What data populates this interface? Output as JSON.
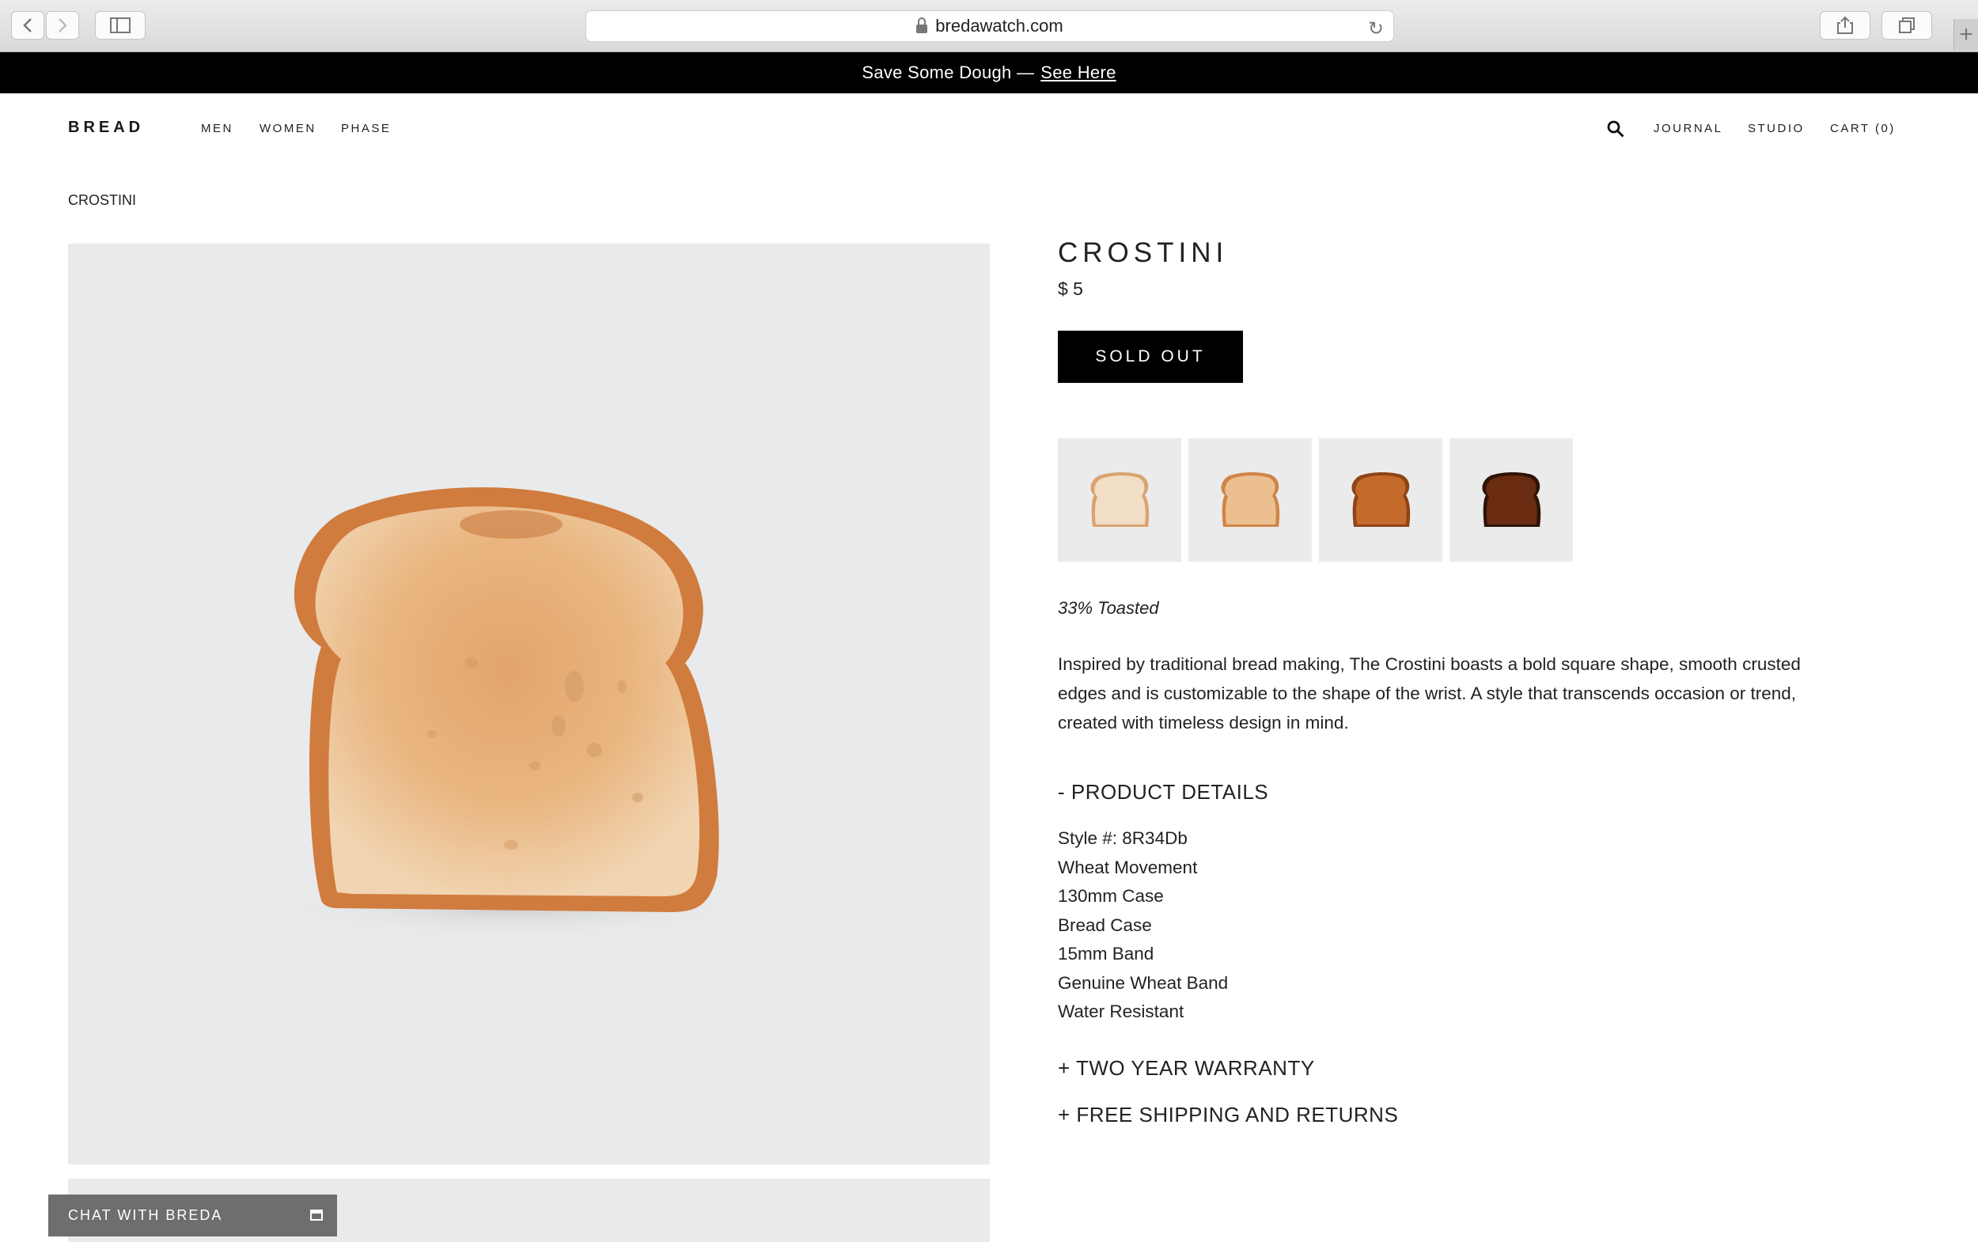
{
  "browser": {
    "url": "bredawatch.com"
  },
  "announcement": {
    "text": "Save Some Dough —",
    "link": "See Here"
  },
  "header": {
    "logo": "BREAD",
    "nav_left": [
      "MEN",
      "WOMEN",
      "PHASE"
    ],
    "nav_right": [
      "JOURNAL",
      "STUDIO",
      "CART (0)"
    ]
  },
  "breadcrumb": "CROSTINI",
  "product": {
    "title": "CROSTINI",
    "price": "$ 5",
    "button": "SOLD OUT",
    "variant": "33% Toasted",
    "description": "Inspired by traditional bread making, The Crostini boasts a bold square shape, smooth crusted edges and is customizable to the shape of the wrist. A style that transcends occasion or trend, created with timeless design in mind.",
    "details_heading": "- PRODUCT DETAILS",
    "details": [
      "Style #: 8R34Db",
      "Wheat Movement",
      "130mm Case",
      "Bread Case",
      "15mm Band",
      "Genuine Wheat Band",
      "Water Resistant"
    ],
    "warranty": "+ TWO YEAR WARRANTY",
    "shipping": "+ FREE SHIPPING AND RETURNS"
  },
  "chat": {
    "label": "CHAT WITH BREDA"
  },
  "icons": [
    "back-icon",
    "forward-icon",
    "sidebar-icon",
    "lock-icon",
    "reload-icon",
    "share-icon",
    "tabs-icon",
    "new-tab-icon",
    "search-icon",
    "chat-window-icon"
  ],
  "colors": {
    "announcement_bg": "#000000",
    "button_bg": "#000000",
    "chat_bg": "#6e6e6e",
    "image_bg": "#e9eaeb"
  }
}
